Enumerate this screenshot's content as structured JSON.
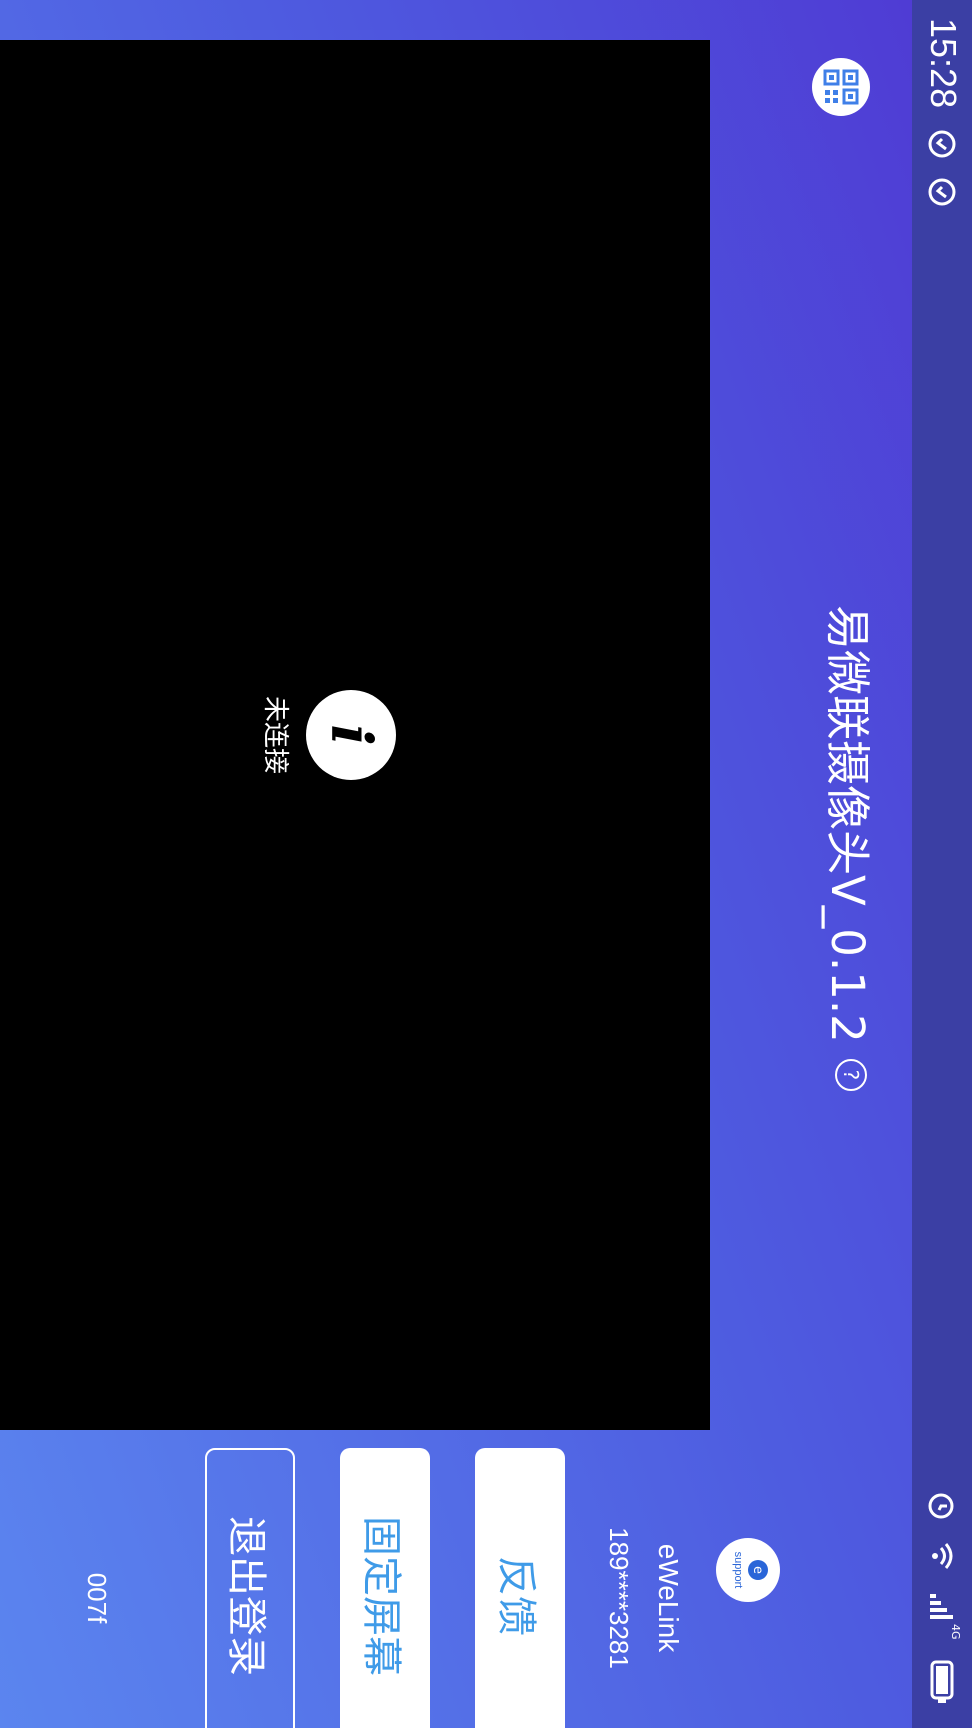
{
  "status_bar": {
    "time": "15:28",
    "network": "4G"
  },
  "header": {
    "title": "易微联摄像头V_0.1.2",
    "help_symbol": "?"
  },
  "video": {
    "status_text": "未连接",
    "info_symbol": "i"
  },
  "account": {
    "brand_label": "support",
    "brand_letter": "e",
    "name": "eWeLink",
    "phone": "189****3281"
  },
  "buttons": {
    "feedback": "反馈",
    "fix_screen": "固定屏幕",
    "logout": "退出登录"
  },
  "device_code": "007f",
  "colors": {
    "accent_blue": "#3f9be8",
    "status_bar": "#3b3fa4",
    "gradient_start": "#4f39d3",
    "gradient_end": "#5b85ef"
  },
  "icons": [
    "qr-code-icon",
    "help-icon",
    "info-icon",
    "support-icon",
    "alarm-icon",
    "wifi-icon",
    "signal-icon",
    "battery-icon"
  ]
}
